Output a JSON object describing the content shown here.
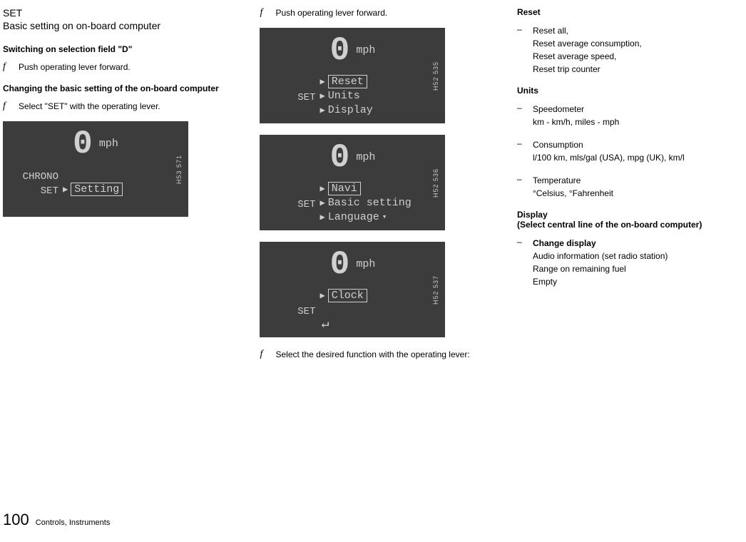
{
  "col1": {
    "title": "SET",
    "subtitle": "Basic setting on on-board computer",
    "h1": "Switching on selection field \"D\"",
    "s1_marker": "f",
    "s1_text": "Push operating lever forward.",
    "h2": "Changing the basic setting of the on-board computer",
    "s2_marker": "f",
    "s2_text": "Select \"SET\" with the operating lever.",
    "lcd1": {
      "speed": "0",
      "unit": "mph",
      "left_top": "CHRONO",
      "left_sel": "SET",
      "sel": "Setting",
      "label": "H53 571"
    }
  },
  "col2": {
    "s1_marker": "f",
    "s1_text": "Push operating lever forward.",
    "lcd2": {
      "speed": "0",
      "unit": "mph",
      "left_sel": "SET",
      "sel": "Reset",
      "r2": "Units",
      "r3": "Display",
      "label": "H52 535"
    },
    "lcd3": {
      "speed": "0",
      "unit": "mph",
      "left_sel": "SET",
      "sel": "Navi",
      "r2": "Basic setting",
      "r3": "Language",
      "label": "H52 536"
    },
    "lcd4": {
      "speed": "0",
      "unit": "mph",
      "left_sel": "SET",
      "sel": "Clock",
      "label": "H52 537"
    },
    "s2_marker": "f",
    "s2_text": "Select the desired function with the operating lever:"
  },
  "col3": {
    "h_reset": "Reset",
    "reset_dash": "–",
    "reset_text": "Reset all,\nReset average consumption,\nReset average speed,\nReset trip counter",
    "h_units": "Units",
    "u1_dash": "–",
    "u1_label": "Speedometer",
    "u1_text": "km - km/h, miles - mph",
    "u2_dash": "–",
    "u2_label": "Consumption",
    "u2_text": "l/100 km, mls/gal (USA), mpg (UK), km/l",
    "u3_dash": "–",
    "u3_label": "Temperature",
    "u3_text": " °Celsius, °Fahrenheit",
    "h_display": "Display",
    "h_display2": "(Select central line of the on-board computer)",
    "d1_dash": "–",
    "d1_bold": "Change display",
    "d1_l1": "Audio information (set radio station)",
    "d1_l2": "Range on remaining fuel",
    "d1_l3": "Empty"
  },
  "footer": {
    "page": "100",
    "section": "Controls, Instruments"
  }
}
